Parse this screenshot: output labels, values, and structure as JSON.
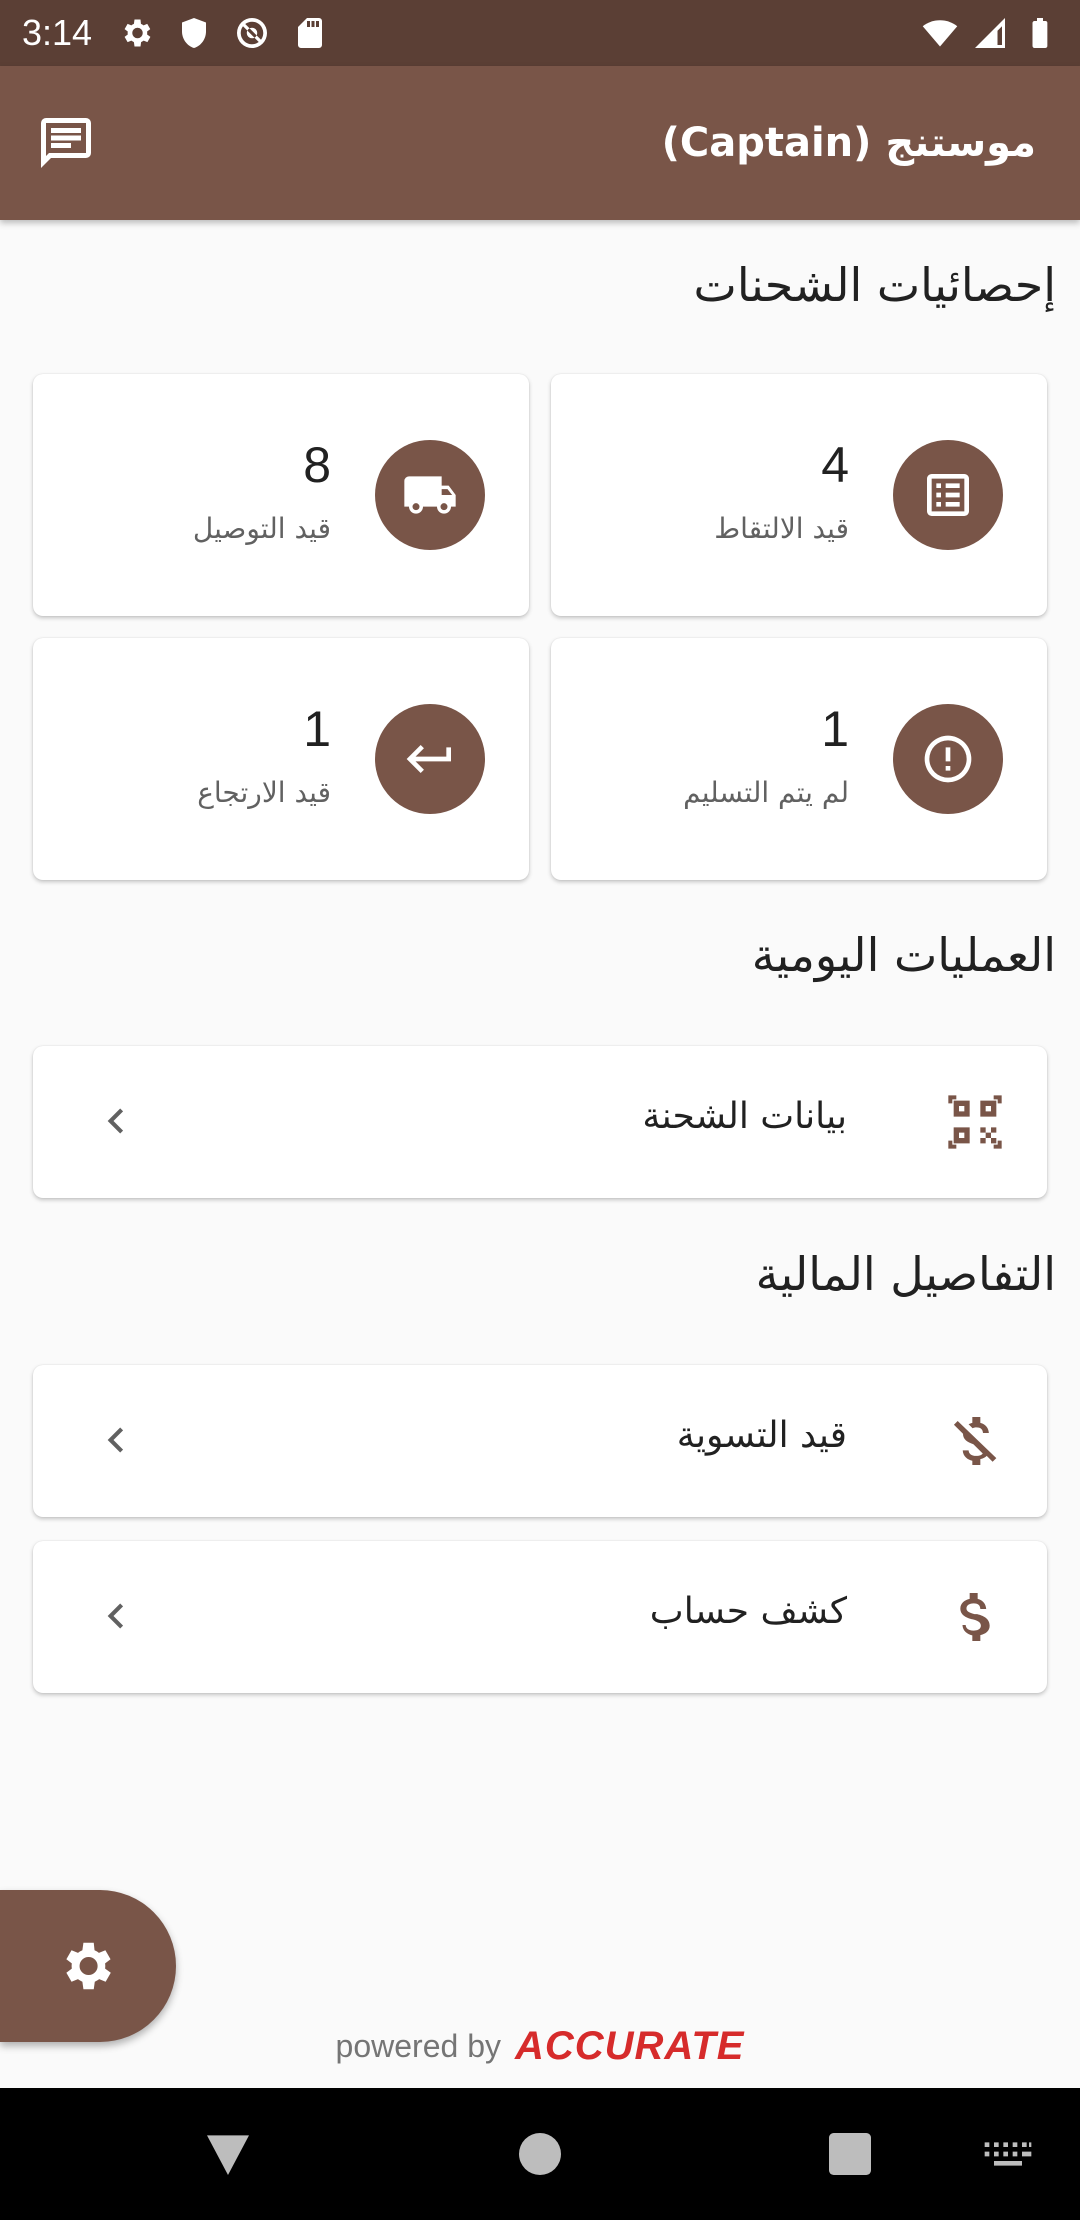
{
  "status_bar": {
    "time": "3:14",
    "left_icons": [
      "gear-icon",
      "shield-icon",
      "at-sign-icon",
      "sd-card-icon"
    ],
    "right_icons": [
      "wifi-icon",
      "cellular-signal-icon",
      "battery-icon"
    ]
  },
  "app_bar": {
    "title": "موستنج (Captain)",
    "action_icon": "chat-icon"
  },
  "shipment_stats": {
    "title": "إحصائيات الشحنات",
    "cards": [
      {
        "value": "4",
        "label": "قيد الالتقاط",
        "icon": "list-icon"
      },
      {
        "value": "8",
        "label": "قيد التوصيل",
        "icon": "truck-icon"
      },
      {
        "value": "1",
        "label": "لم يتم التسليم",
        "icon": "alert-circle-icon"
      },
      {
        "value": "1",
        "label": "قيد الارتجاع",
        "icon": "return-arrow-icon"
      }
    ]
  },
  "daily_operations": {
    "title": "العمليات اليومية",
    "items": [
      {
        "label": "بيانات الشحنة",
        "icon": "qr-code-icon"
      }
    ]
  },
  "financial_details": {
    "title": "التفاصيل المالية",
    "items": [
      {
        "label": "قيد التسوية",
        "icon": "dollar-off-icon"
      },
      {
        "label": "كشف حساب",
        "icon": "dollar-icon"
      }
    ]
  },
  "footer": {
    "powered_by": "powered by",
    "brand": "ACCURATE"
  },
  "colors": {
    "primary": "#795548",
    "status_bar": "#5b3f35",
    "brand_red": "#d62b2b"
  }
}
